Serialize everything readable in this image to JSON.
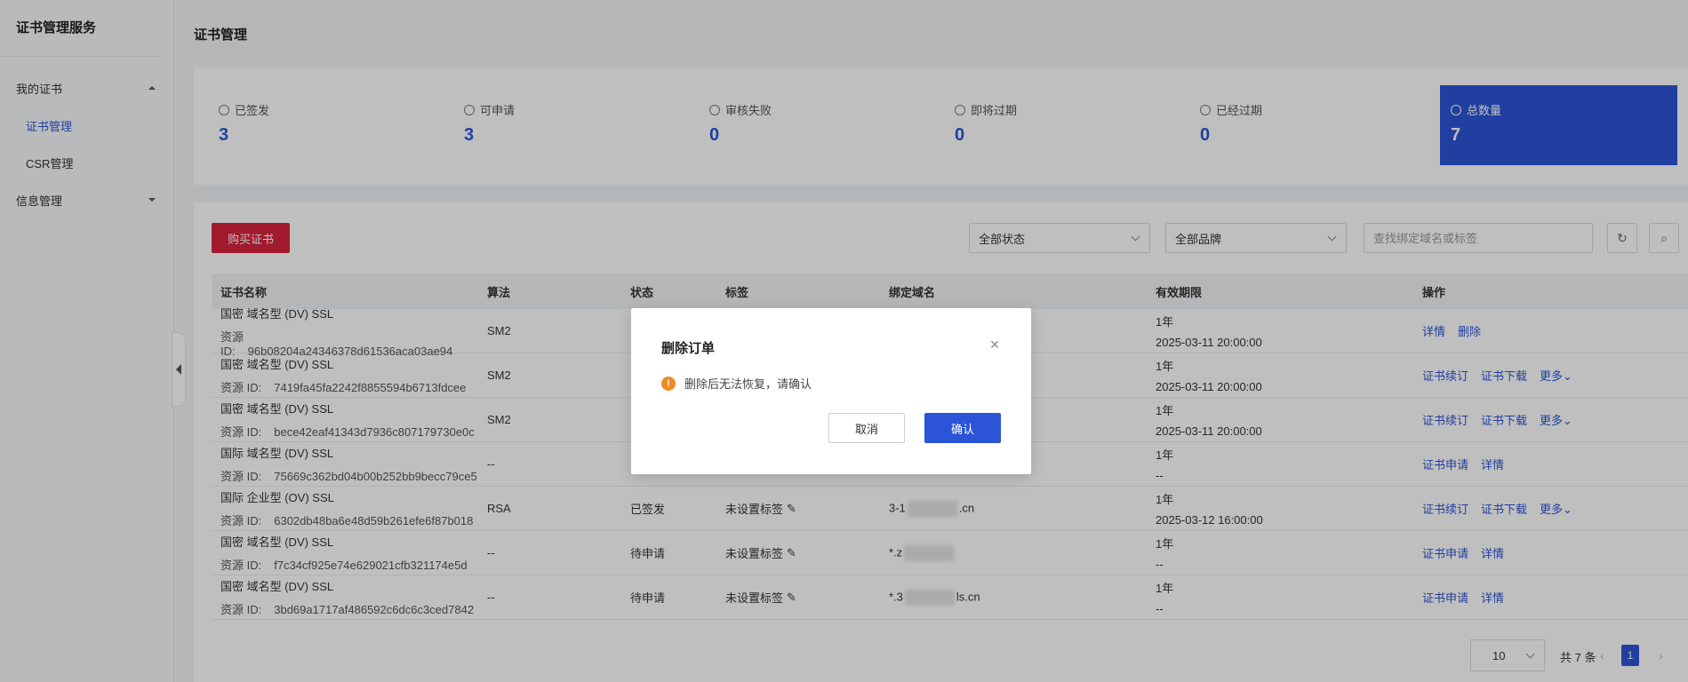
{
  "sidebar": {
    "app_title": "证书管理服务",
    "groups": [
      {
        "label": "我的证书",
        "items": [
          {
            "label": "证书管理"
          },
          {
            "label": "CSR管理"
          }
        ]
      },
      {
        "label": "信息管理"
      }
    ]
  },
  "page": {
    "title": "证书管理"
  },
  "stats": [
    {
      "label": "已签发",
      "value": "3",
      "icon": "signed-icon"
    },
    {
      "label": "可申请",
      "value": "3",
      "icon": "applicable-icon"
    },
    {
      "label": "审核失败",
      "value": "0",
      "icon": "review-failed-icon"
    },
    {
      "label": "即将过期",
      "value": "0",
      "icon": "clock-icon"
    },
    {
      "label": "已经过期",
      "value": "0",
      "icon": "warning-icon"
    },
    {
      "label": "总数量",
      "value": "7",
      "icon": "cloud-icon"
    }
  ],
  "toolbar": {
    "buy_label": "购买证书",
    "status_select": "全部状态",
    "brand_select": "全部品牌",
    "search_placeholder": "查找绑定域名或标签"
  },
  "table": {
    "headers": [
      "证书名称",
      "算法",
      "状态",
      "标签",
      "绑定域名",
      "有效期限",
      "操作"
    ],
    "rows": [
      {
        "name": "国密 域名型 (DV) SSL",
        "rid_label": "资源 ID:",
        "rid": "96b08204a24346378d61536aca03ae94",
        "algo": "SM2",
        "status": "",
        "tag": "",
        "domain": "",
        "term": "1年",
        "date": "2025-03-11 20:00:00",
        "actions": [
          "详情",
          "删除"
        ],
        "more": ""
      },
      {
        "name": "国密 域名型 (DV) SSL",
        "rid_label": "资源 ID:",
        "rid": "7419fa45fa2242f8855594b6713fdcee",
        "algo": "SM2",
        "status": "",
        "tag": "",
        "domain": "",
        "term": "1年",
        "date": "2025-03-11 20:00:00",
        "actions": [
          "证书续订",
          "证书下载"
        ],
        "more": "更多"
      },
      {
        "name": "国密 域名型 (DV) SSL",
        "rid_label": "资源 ID:",
        "rid": "bece42eaf41343d7936c807179730e0c",
        "algo": "SM2",
        "status": "",
        "tag": "",
        "domain": "",
        "term": "1年",
        "date": "2025-03-11 20:00:00",
        "actions": [
          "证书续订",
          "证书下载"
        ],
        "more": "更多"
      },
      {
        "name": "国际 域名型 (DV) SSL",
        "rid_label": "资源 ID:",
        "rid": "75669c362bd04b00b252bb9becc79ce5",
        "algo": "--",
        "status": "",
        "tag": "",
        "domain": "",
        "term": "1年",
        "date": "--",
        "actions": [
          "证书申请",
          "详情"
        ],
        "more": ""
      },
      {
        "name": "国际 企业型 (OV) SSL",
        "rid_label": "资源 ID:",
        "rid": "6302db48ba6e48d59b261efe6f87b018",
        "algo": "RSA",
        "status": "已签发",
        "tag": "未设置标签",
        "domain_pre": "3-1",
        "domain_post": ".cn",
        "term": "1年",
        "date": "2025-03-12 16:00:00",
        "actions": [
          "证书续订",
          "证书下载"
        ],
        "more": "更多"
      },
      {
        "name": "国密 域名型 (DV) SSL",
        "rid_label": "资源 ID:",
        "rid": "f7c34cf925e74e629021cfb321174e5d",
        "algo": "--",
        "status": "待申请",
        "tag": "未设置标签",
        "domain_pre": "*.z",
        "domain_post": "",
        "term": "1年",
        "date": "--",
        "actions": [
          "证书申请",
          "详情"
        ],
        "more": ""
      },
      {
        "name": "国密 域名型 (DV) SSL",
        "rid_label": "资源 ID:",
        "rid": "3bd69a1717af486592c6dc6c3ced7842",
        "algo": "--",
        "status": "待申请",
        "tag": "未设置标签",
        "domain_pre": "*.3",
        "domain_post": "ls.cn",
        "term": "1年",
        "date": "--",
        "actions": [
          "证书申请",
          "详情"
        ],
        "more": ""
      }
    ]
  },
  "pagination": {
    "page_size": "10",
    "total": "共 7 条",
    "current": "1"
  },
  "modal": {
    "title": "删除订单",
    "message": "删除后无法恢复，请确认",
    "cancel": "取消",
    "confirm": "确认"
  },
  "colors": {
    "accent": "#2b55d6",
    "danger": "#d9233c",
    "warning": "#f08a24"
  }
}
